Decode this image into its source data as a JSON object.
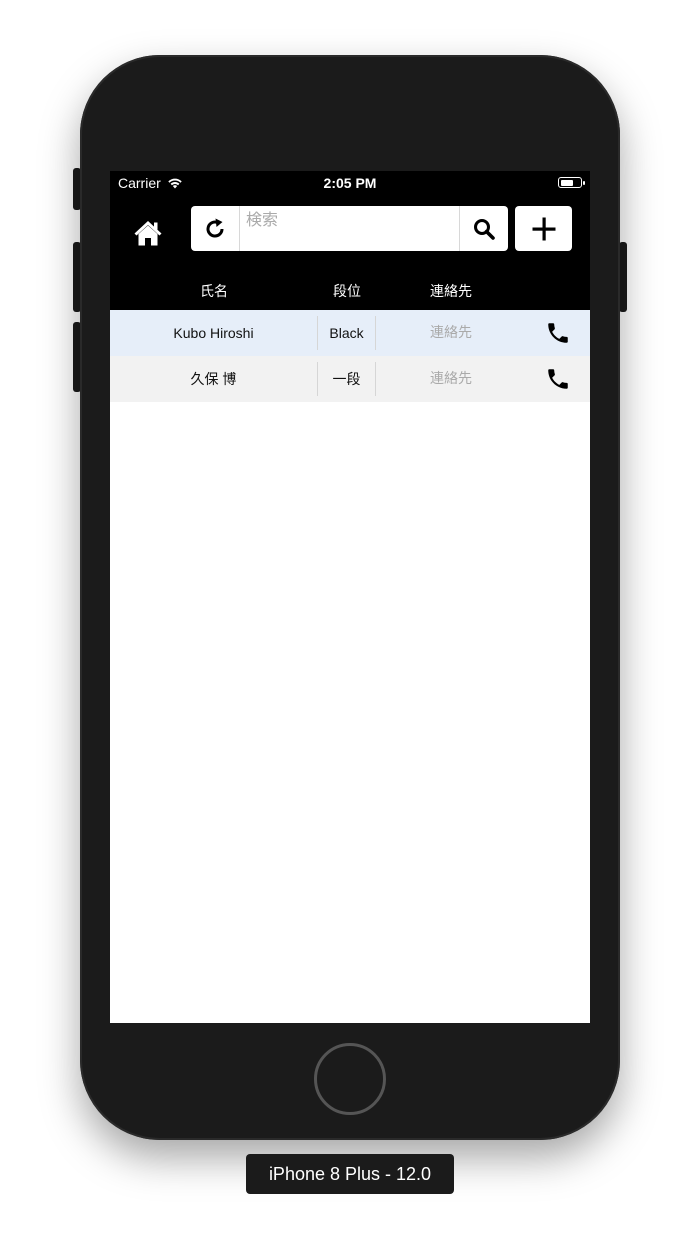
{
  "device": {
    "label": "iPhone 8 Plus - 12.0"
  },
  "statusbar": {
    "carrier": "Carrier",
    "time": "2:05 PM",
    "battery_level": 0.7
  },
  "toolbar": {
    "home_icon": "home-icon",
    "refresh_icon": "refresh-icon",
    "search_icon": "search-icon",
    "add_icon": "plus-icon",
    "search_placeholder": "検索",
    "search_value": ""
  },
  "table": {
    "headers": {
      "name": "氏名",
      "rank": "段位",
      "contact": "連絡先"
    },
    "rows": [
      {
        "name": "Kubo Hiroshi",
        "rank": "Black",
        "contact": "連絡先",
        "phone_icon": "phone-icon"
      },
      {
        "name": "久保 博",
        "rank": "一段",
        "contact": "連絡先",
        "phone_icon": "phone-icon"
      }
    ]
  },
  "colors": {
    "bar_background": "#000000",
    "row_highlight": "#e6eef9",
    "row_alt": "#f2f2f2",
    "placeholder": "#aaaaaa"
  }
}
